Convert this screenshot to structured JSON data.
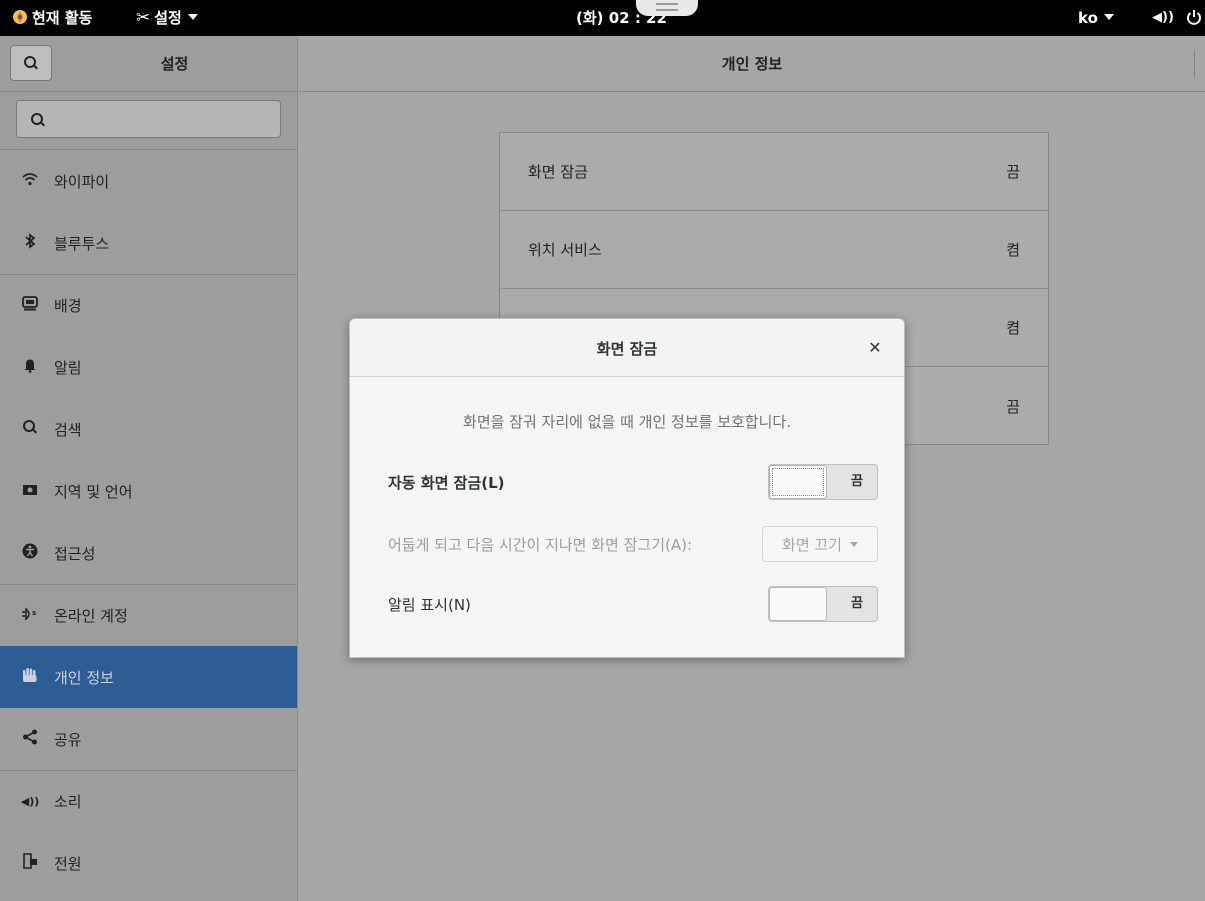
{
  "topbar": {
    "activities": "현재 활동",
    "app_menu": "설정",
    "clock": "(화) 02 : 22",
    "language": "ko"
  },
  "sidebar": {
    "title": "설정",
    "items": [
      {
        "label": "와이파이",
        "icon": "wifi-icon"
      },
      {
        "label": "블루투스",
        "icon": "bluetooth-icon"
      },
      {
        "label": "배경",
        "icon": "background-icon"
      },
      {
        "label": "알림",
        "icon": "bell-icon"
      },
      {
        "label": "검색",
        "icon": "search-icon"
      },
      {
        "label": "지역 및 언어",
        "icon": "region-icon"
      },
      {
        "label": "접근성",
        "icon": "accessibility-icon"
      },
      {
        "label": "온라인 계정",
        "icon": "online-accounts-icon"
      },
      {
        "label": "개인 정보",
        "icon": "hand-icon"
      },
      {
        "label": "공유",
        "icon": "share-icon"
      },
      {
        "label": "소리",
        "icon": "speaker-icon"
      },
      {
        "label": "전원",
        "icon": "power-icon"
      }
    ],
    "active": "개인 정보"
  },
  "content": {
    "title": "개인 정보",
    "rows": [
      {
        "label": "화면 잠금",
        "value": "끔"
      },
      {
        "label": "위치 서비스",
        "value": "켬"
      },
      {
        "label": "",
        "value": "켬"
      },
      {
        "label": "",
        "value": "끔"
      }
    ]
  },
  "dialog": {
    "title": "화면 잠금",
    "description": "화면을 잠궈 자리에 없을 때 개인 정보를 보호합니다.",
    "auto_lock_label": "자동 화면 잠금(L)",
    "auto_lock_state": "끔",
    "delay_label": "어둡게 되고 다음 시간이 지나면 화면 잠그기(A):",
    "delay_value": "화면 끄기",
    "show_notifications_label": "알림 표시(N)",
    "show_notifications_state": "끔"
  },
  "colors": {
    "topbar": "#000000",
    "active_item": "#2d5d93",
    "dialog_bg": "#f5f5f4"
  }
}
